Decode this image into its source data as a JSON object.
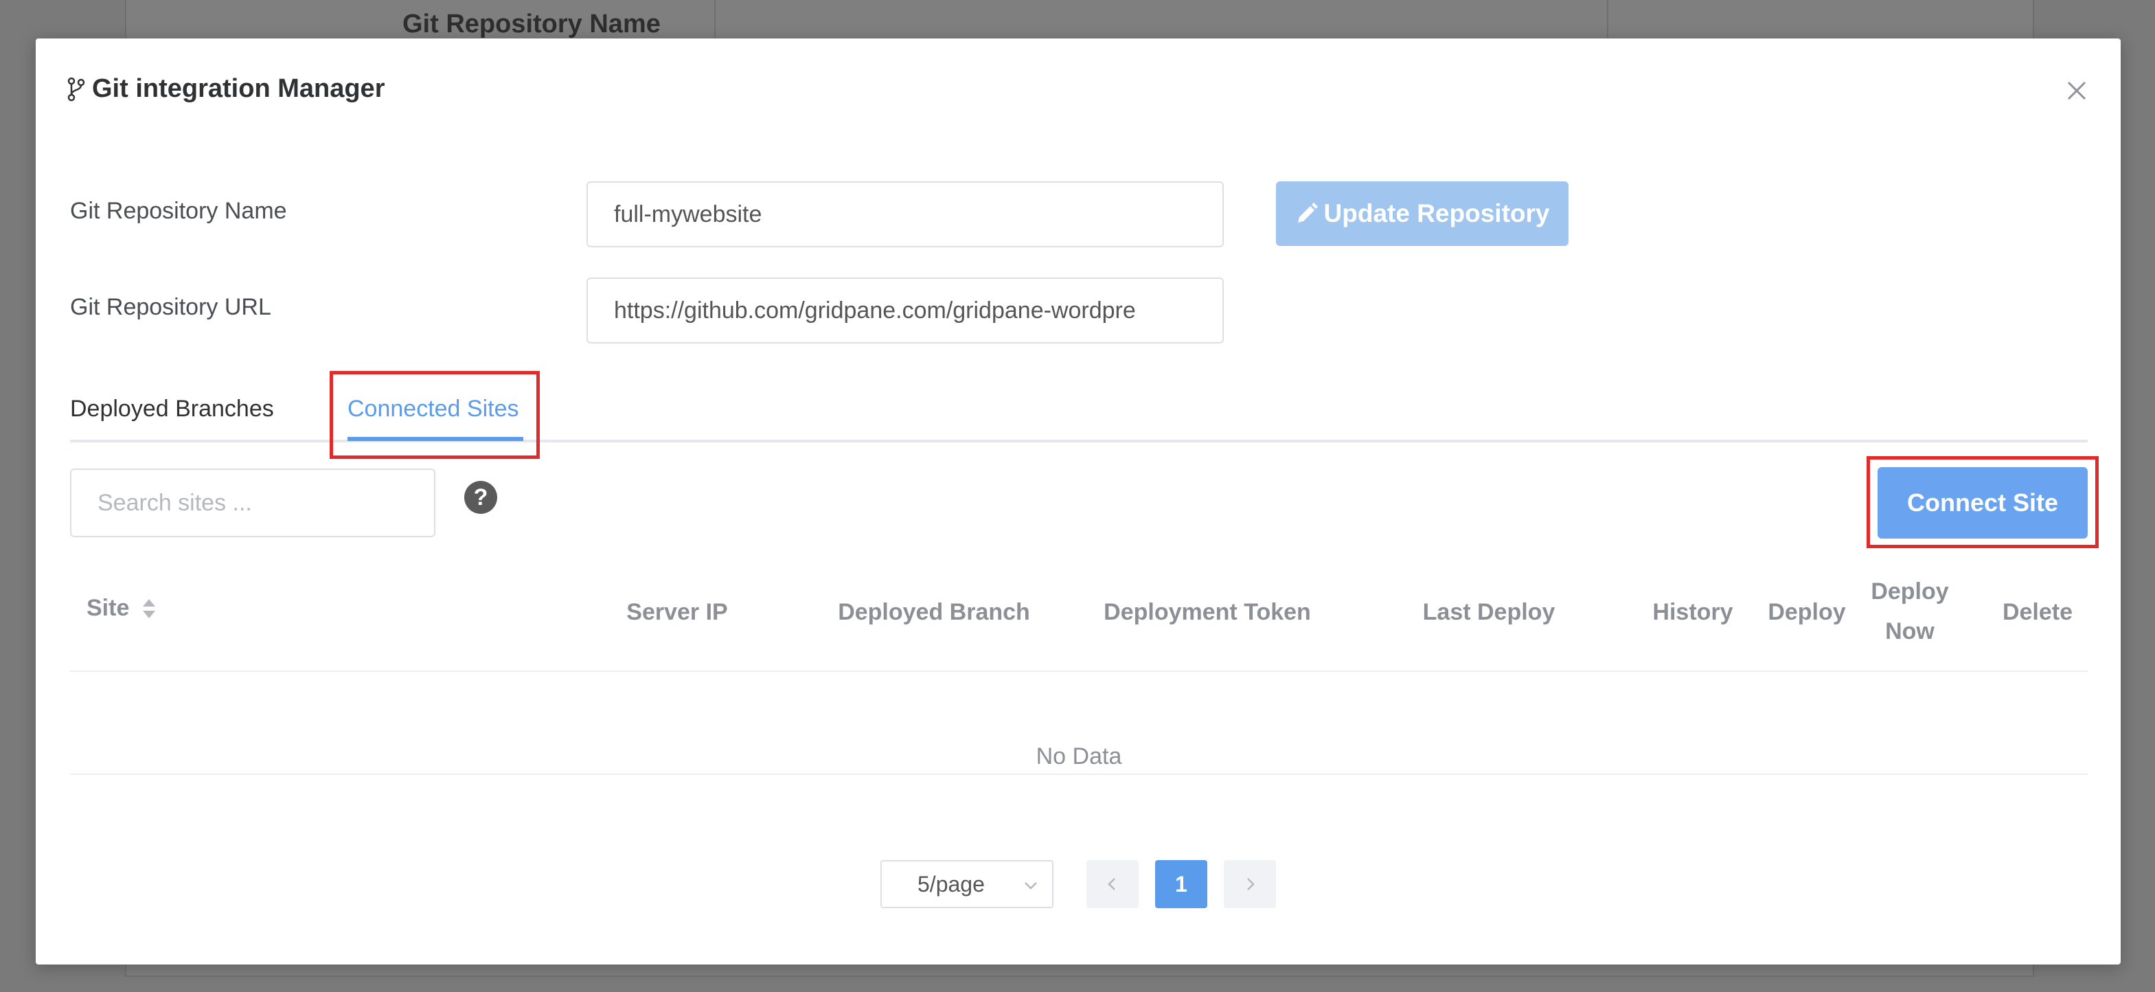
{
  "background": {
    "heading": "Git Repository Name"
  },
  "modal": {
    "title": "Git integration Manager",
    "form": {
      "repo_name_label": "Git Repository Name",
      "repo_name_value": "full-mywebsite",
      "repo_url_label": "Git Repository URL",
      "repo_url_value": "https://github.com/gridpane.com/gridpane-wordpre",
      "update_button": "Update Repository"
    },
    "tabs": [
      {
        "label": "Deployed Branches",
        "active": false
      },
      {
        "label": "Connected Sites",
        "active": true
      }
    ],
    "search": {
      "placeholder": "Search sites ..."
    },
    "help_symbol": "?",
    "connect_button": "Connect Site",
    "table": {
      "columns": [
        "Site",
        "Server IP",
        "Deployed Branch",
        "Deployment Token",
        "Last Deploy",
        "History",
        "Deploy",
        "Deploy Now",
        "Delete"
      ],
      "empty_text": "No Data"
    },
    "pagination": {
      "page_size": "5/page",
      "current_page": "1"
    }
  },
  "colors": {
    "accent": "#5b9bec",
    "highlight": "#e02b2b"
  }
}
